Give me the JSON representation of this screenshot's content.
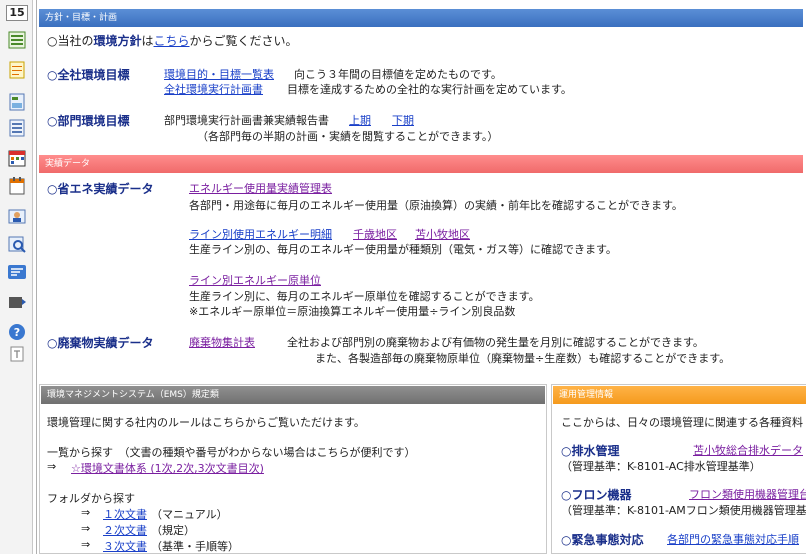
{
  "toolbar": {
    "number": "15",
    "icons": [
      "menu-list-icon",
      "notepad-icon",
      "document-icon",
      "form-icon",
      "calendar-grid-icon",
      "calendar-icon",
      "person-card-icon",
      "search-person-icon",
      "news-icon",
      "folder-arrow-icon",
      "help-icon",
      "tool-icon"
    ]
  },
  "policy": {
    "header": "方針・目標・計画",
    "line1_prefix": "○当社の",
    "line1_bold": "環境方針",
    "line1_mid": "は",
    "line1_link": "こちら",
    "line1_suffix": "からご覧ください。",
    "corp_title": "○全社環境目標",
    "corp_link1": "環境目的・目標一覧表",
    "corp_desc1": "向こう３年間の目標値を定めたものです。",
    "corp_link2": "全社環境実行計画書",
    "corp_desc2": "目標を達成するための全社的な実行計画を定めています。",
    "dept_title": "○部門環境目標",
    "dept_desc": "部門環境実行計画書兼実績報告書",
    "dept_link1": "上期",
    "dept_link2": "下期",
    "dept_note": "（各部門毎の半期の計画・実績を閲覧することができます。）"
  },
  "results": {
    "header": "実績データ",
    "energy_title": "○省エネ実績データ",
    "energy_link": "エネルギー使用量実績管理表",
    "energy_desc": "各部門・用途毎に毎月のエネルギー使用量（原油換算）の実績・前年比を確認することができます。",
    "line_link": "ライン別使用エネルギー明細",
    "line_link_a": "千歳地区",
    "line_link_b": "苫小牧地区",
    "line_desc": "生産ライン別の、毎月のエネルギー使用量が種類別（電気・ガス等）に確認できます。",
    "unit_link": "ライン別エネルギー原単位",
    "unit_desc1": "生産ライン別に、毎月のエネルギー原単位を確認することができます。",
    "unit_desc2": "※エネルギー原単位＝原油換算エネルギー使用量÷ライン別良品数",
    "waste_title": "○廃棄物実績データ",
    "waste_link": "廃棄物集計表",
    "waste_desc1": "全社および部門別の廃棄物および有価物の発生量を月別に確認することができます。",
    "waste_desc2": "また、各製造部毎の廃棄物原単位（廃棄物量÷生産数）も確認することができます。"
  },
  "ems": {
    "header": "環境マネジメントシステム（EMS）規定類",
    "intro": "環境管理に関する社内のルールはこちらからご覧いただけます。",
    "list_title": "一覧から探す　（文書の種類や番号がわからない場合はこちらが便利です）",
    "arrow": "⇒",
    "list_link": "☆環境文書体系 (1次,2次,3次文書目次)",
    "folder_title": "フォルダから探す",
    "doc1_link": "１次文書",
    "doc1_note": "（マニュアル）",
    "doc2_link": "２次文書",
    "doc2_note": "（規定）",
    "doc3_link": "３次文書",
    "doc3_note": "（基準・手順等）"
  },
  "ops": {
    "header": "運用管理情報",
    "intro": "ここからは、日々の環境管理に関連する各種資料",
    "drain_title": "○排水管理",
    "drain_link": "苫小牧総合排水データ",
    "drain_note": "（管理基準：K-8101-AC排水管理基準）",
    "freon_title": "○フロン機器",
    "freon_link": "フロン類使用機器管理台",
    "freon_note": "（管理基準：K-8101-AMフロン類使用機器管理基",
    "emerg_title": "○緊急事態対応",
    "emerg_link": "各部門の緊急事態対応手順"
  },
  "colors": {
    "header_blue": "#3a6fbf",
    "header_red": "#f06a6a",
    "header_gray": "#707070",
    "header_orange": "#f59a1d",
    "link": "#1a40c8",
    "visited_link": "#7a1fa0",
    "title": "#1a2f8a"
  }
}
